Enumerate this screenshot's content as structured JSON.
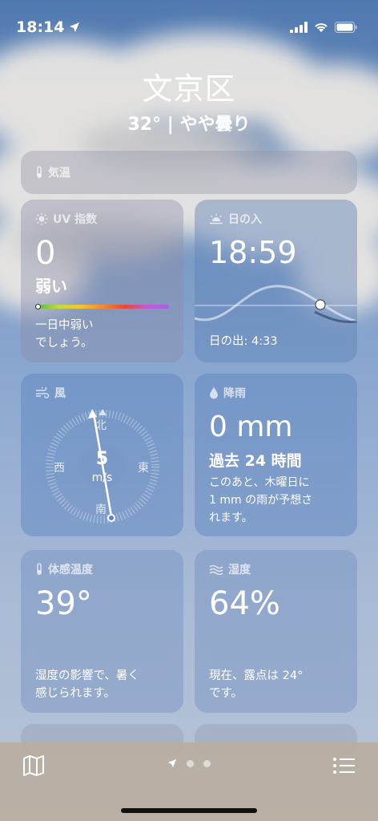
{
  "status": {
    "time": "18:14"
  },
  "header": {
    "city": "文京区",
    "conditions": "32° | やや曇り"
  },
  "temperature_card": {
    "title": "気温"
  },
  "uv_card": {
    "title": "UV 指数",
    "value": "0",
    "level": "弱い",
    "description_line1": "一日中弱い",
    "description_line2": "でしょう。",
    "position": 0
  },
  "sunset_card": {
    "title": "日の入",
    "value": "18:59",
    "sunrise": "日の出: 4:33"
  },
  "wind_card": {
    "title": "風",
    "speed": "5",
    "unit": "m/s",
    "north": "北",
    "south": "南",
    "east": "東",
    "west": "西"
  },
  "rain_card": {
    "title": "降雨",
    "value": "0 mm",
    "period": "過去 24 時間",
    "description_line1": "このあと、木曜日に",
    "description_line2": "1 mm の雨が予想さ",
    "description_line3": "れます。"
  },
  "feels_like_card": {
    "title": "体感温度",
    "value": "39°",
    "description_line1": "湿度の影響で、暑く",
    "description_line2": "感じられます。"
  },
  "humidity_card": {
    "title": "湿度",
    "value": "64%",
    "description_line1": "現在、露点は 24°",
    "description_line2": "です。"
  },
  "colors": {
    "uv_gradient": [
      "#47c04b",
      "#c6d93a",
      "#f4c431",
      "#f28a2d",
      "#e8483a",
      "#c35bd6"
    ],
    "accent": "#ffffff"
  },
  "icons": {
    "map": "map-icon",
    "list": "list-icon",
    "location": "location-arrow-icon"
  }
}
